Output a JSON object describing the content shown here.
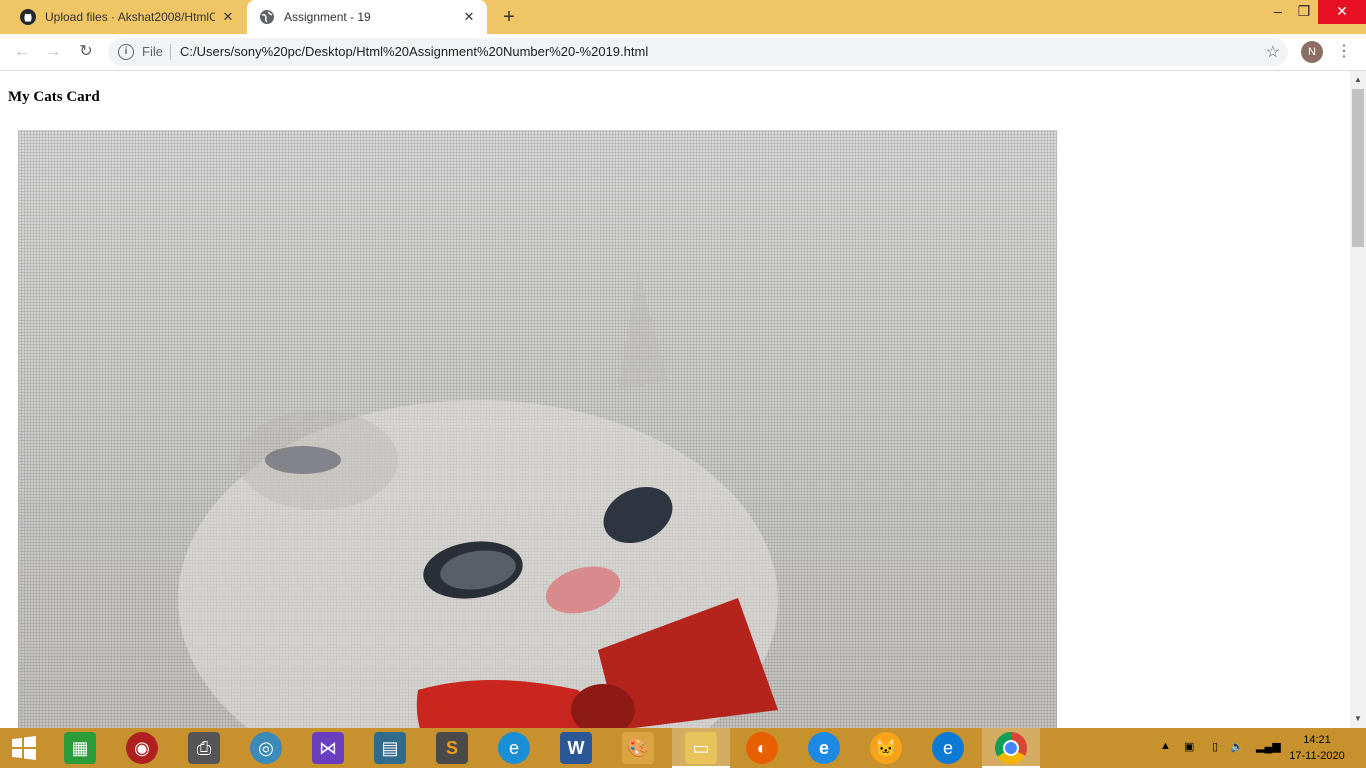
{
  "browser": {
    "tabs": [
      {
        "title": "Upload files · Akshat2008/HtmlC",
        "icon": "github-icon",
        "active": false
      },
      {
        "title": "Assignment - 19",
        "icon": "globe-icon",
        "active": true
      }
    ],
    "omnibox": {
      "scheme_label": "File",
      "url": "C:/Users/sony%20pc/Desktop/Html%20Assignment%20Number%20-%2019.html"
    },
    "profile_initial": "N"
  },
  "page": {
    "heading": "My Cats Card",
    "image": {
      "subject": "white kitten with red bow"
    }
  },
  "taskbar": {
    "apps": [
      "start",
      "store",
      "screen-recorder",
      "printer",
      "media",
      "visual-studio",
      "film",
      "sublime-text",
      "edge",
      "word",
      "paint",
      "file-explorer",
      "firefox",
      "internet-explorer",
      "scratch",
      "edge-new",
      "chrome"
    ],
    "clock": {
      "time": "14:21",
      "date": "17-11-2020"
    }
  },
  "colors": {
    "tabstrip": "#f0c566",
    "taskbar": "#c7922e",
    "close": "#e81123"
  }
}
